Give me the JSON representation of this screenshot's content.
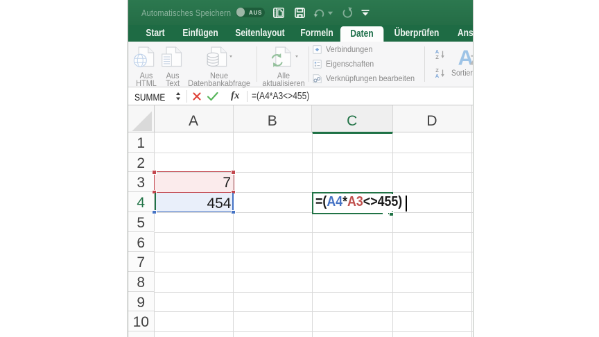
{
  "colors": {
    "excel_green": "#217346",
    "title_green": "#2b7a50",
    "tabbar_green": "#1e6b44",
    "reference_blue": "#4472c4",
    "reference_red": "#c0504d",
    "a3_fill": "#fbebec",
    "a4_fill": "#e9effa",
    "ribbon_bg": "#f6f6f7",
    "disabled_label_gray": "#8c8c8c"
  },
  "titlebar": {
    "autosave_label": "Automatisches Speichern",
    "autosave_state": "AUS",
    "icons": [
      "new-workbook-icon",
      "save-icon",
      "undo-icon",
      "undo-dropdown-icon",
      "redo-icon",
      "customize-toolbar-icon"
    ]
  },
  "tabs": [
    {
      "label": "Start",
      "active": false
    },
    {
      "label": "Einfügen",
      "active": false
    },
    {
      "label": "Seitenlayout",
      "active": false
    },
    {
      "label": "Formeln",
      "active": false
    },
    {
      "label": "Daten",
      "active": true
    },
    {
      "label": "Überprüfen",
      "active": false
    },
    {
      "label": "Ansicht",
      "active": false
    }
  ],
  "ribbon": {
    "big_buttons": [
      {
        "label": "Aus\nHTML",
        "icon": "globe-page-icon",
        "dropdown": false
      },
      {
        "label": "Aus\nText",
        "icon": "text-file-page-icon",
        "dropdown": false
      },
      {
        "label": "Neue\nDatenbankabfrage",
        "icon": "database-page-icon",
        "dropdown": true
      },
      {
        "label": "Alle\naktualisieren",
        "icon": "refresh-page-icon",
        "dropdown": true
      }
    ],
    "connection_items": [
      {
        "label": "Verbindungen",
        "icon": "connections-icon"
      },
      {
        "label": "Eigenschaften",
        "icon": "properties-icon"
      },
      {
        "label": "Verknüpfungen bearbeiten",
        "icon": "edit-links-icon"
      }
    ],
    "sort": {
      "label": "Sortieren",
      "big_letters": [
        "A",
        "Z"
      ],
      "ascending_letters": [
        "A",
        "Z"
      ],
      "descending_letters": [
        "Z",
        "A"
      ]
    }
  },
  "formula_bar": {
    "name_box": "SUMME",
    "formula": "=(A4*A3<>455)",
    "function_label": "fx",
    "icons": [
      "cancel-icon",
      "confirm-icon",
      "function-icon"
    ]
  },
  "grid": {
    "col_labels": [
      "A",
      "B",
      "C",
      "D"
    ],
    "row_labels": [
      "1",
      "2",
      "3",
      "4",
      "5",
      "6",
      "7",
      "8",
      "9",
      "10"
    ],
    "active_column": "C",
    "active_row": "4",
    "cells": {
      "A3": "7",
      "A4": "454"
    },
    "edit_cell": "C4",
    "edit_tokens": [
      {
        "text": "=(",
        "color": "default"
      },
      {
        "text": "A4",
        "color": "ref-blue"
      },
      {
        "text": "*",
        "color": "default"
      },
      {
        "text": "A3",
        "color": "ref-red"
      },
      {
        "text": "<>455)",
        "color": "default"
      }
    ]
  }
}
